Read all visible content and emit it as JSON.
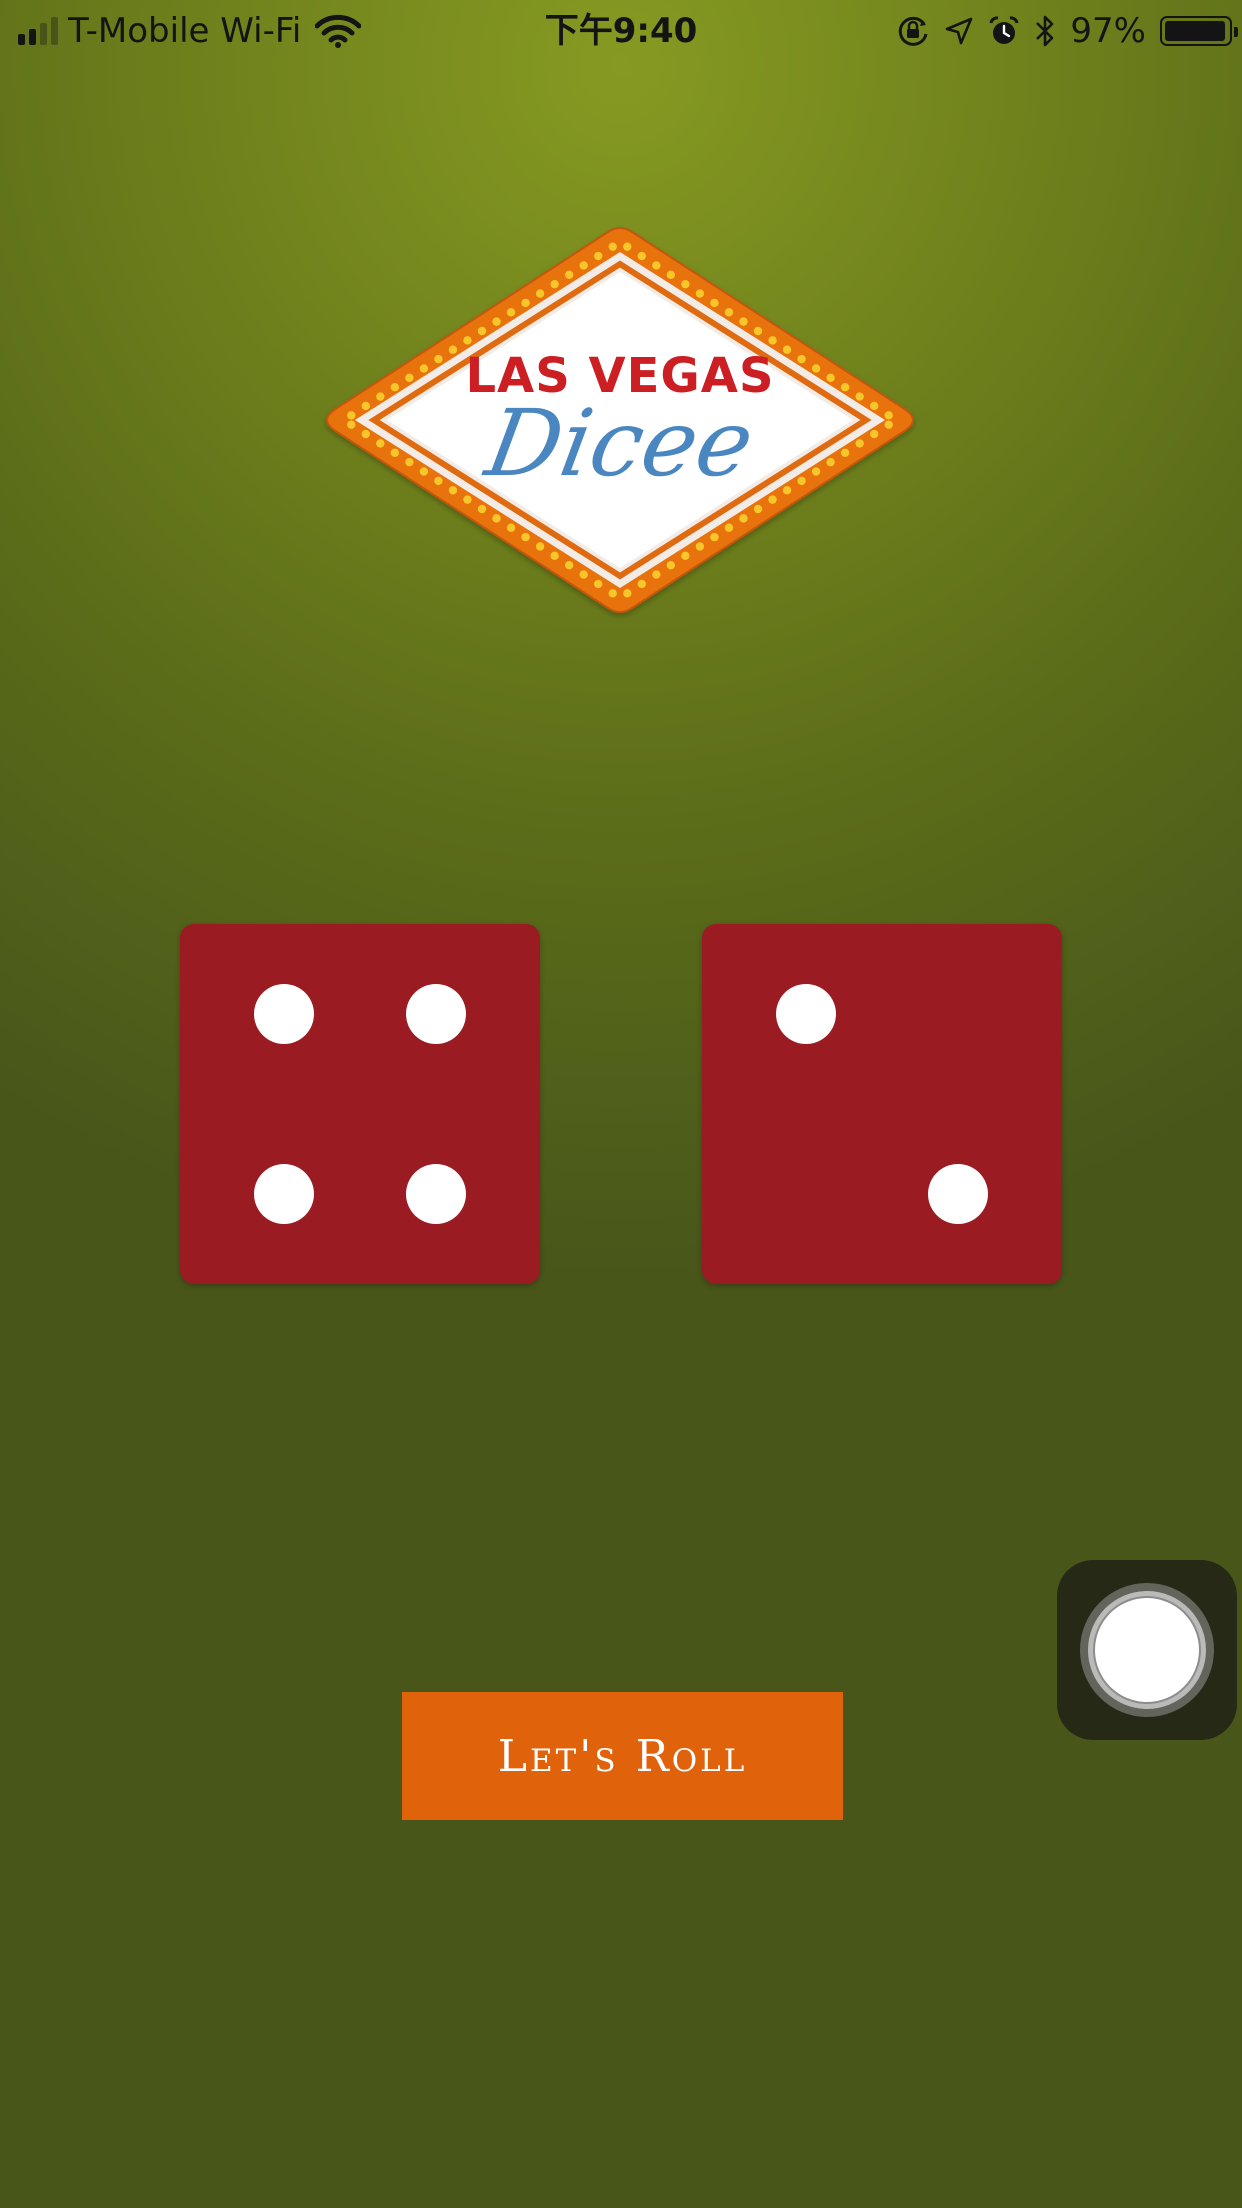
{
  "status_bar": {
    "carrier": "T-Mobile Wi-Fi",
    "time": "下午9:40",
    "battery_percent_text": "97%",
    "battery_level": 0.97,
    "signal_strength_bars": 2,
    "icons": [
      "signal-icon",
      "wifi-icon",
      "orientation-lock-icon",
      "location-icon",
      "alarm-icon",
      "bluetooth-icon",
      "battery-icon"
    ]
  },
  "logo": {
    "title": "LAS VEGAS",
    "script": "Dicee",
    "colors": {
      "title": "#cc1f24",
      "script": "#4a86c0",
      "border": "#e8730e",
      "bulbs": "#f7c62b"
    }
  },
  "dice": [
    {
      "name": "left-die",
      "value": 4
    },
    {
      "name": "right-die",
      "value": 2
    }
  ],
  "roll_button": {
    "label": "Let's Roll",
    "color": "#e0620b"
  },
  "colors": {
    "background": "#6f811c",
    "die": "#9b1b22",
    "pip": "#ffffff"
  }
}
